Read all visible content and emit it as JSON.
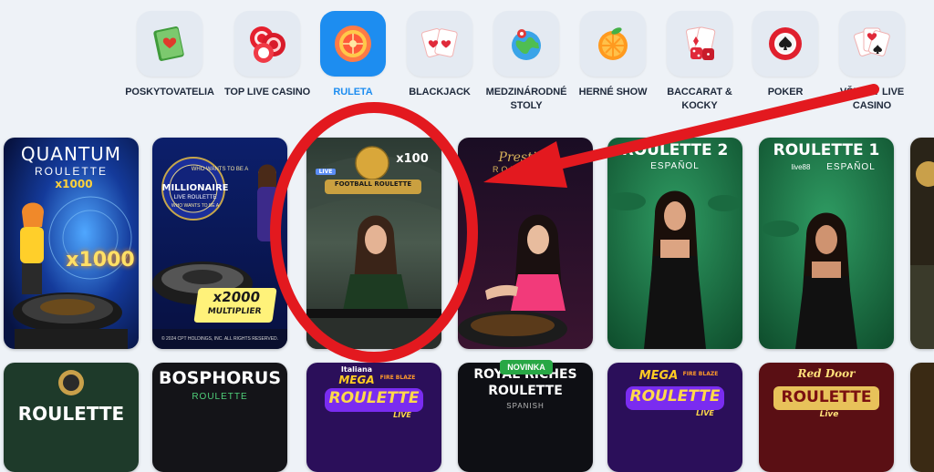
{
  "categories": [
    {
      "label": "POSKYTOVATELIA",
      "icon": "book-heart-icon"
    },
    {
      "label": "TOP LIVE CASINO",
      "icon": "casino-chips-icon"
    },
    {
      "label": "RULETA",
      "icon": "roulette-icon",
      "active": true
    },
    {
      "label": "BLACKJACK",
      "icon": "playing-cards-heart-icon"
    },
    {
      "label": "MEDZINÁRODNÉ STOLY",
      "icon": "globe-pin-icon"
    },
    {
      "label": "HERNÉ SHOW",
      "icon": "orange-slice-icon"
    },
    {
      "label": "BACCARAT & KOCKY",
      "icon": "cards-dice-icon"
    },
    {
      "label": "POKER",
      "icon": "poker-chip-icon"
    },
    {
      "label": "VŠETKY LIVE CASINO",
      "icon": "all-cards-icon"
    }
  ],
  "games_row1": [
    {
      "title": "QUANTUM",
      "subtitle": "ROULETTE",
      "badge": "x1000",
      "badge2": "x1000"
    },
    {
      "title": "MILLIONAIRE",
      "subtitle": "LIVE ROULETTE",
      "top_text": "WHO WANTS TO BE A",
      "bottom_text": "WHO WANTS TO BE A",
      "badge": "x2000",
      "badge2": "MULTIPLIER",
      "copyright": "© 2024 CPT HOLDINGS, INC. ALL RIGHTS RESERVED."
    },
    {
      "title": "FOOTBALL ROULETTE",
      "badge": "x100",
      "live": "LIVE"
    },
    {
      "title": "Prestige",
      "subtitle": "ROULETTE"
    },
    {
      "title": "ROULETTE 2",
      "subtitle": "ESPAÑOL"
    },
    {
      "title": "ROULETTE 1",
      "subtitle": "ESPAÑOL",
      "brand": "live88"
    }
  ],
  "games_row2": [
    {
      "title": "ROULETTE"
    },
    {
      "title": "BOSPHORUS",
      "subtitle": "ROULETTE"
    },
    {
      "title": "ROULETTE",
      "tag": "Italiana",
      "mega": "MEGA",
      "fire": "FIRE BLAZE",
      "live": "LIVE"
    },
    {
      "title": "ROYAL RICHES",
      "title2": "ROULETTE",
      "subtitle": "SPANISH",
      "badge": "NOVINKA"
    },
    {
      "title": "ROULETTE",
      "mega": "MEGA",
      "fire": "FIRE BLAZE",
      "live": "LIVE"
    },
    {
      "title": "ROULETTE",
      "tag": "Red Door",
      "live": "Live"
    }
  ],
  "colors": {
    "accent": "#1d8df0",
    "annotation": "#e3191f",
    "novinka": "#28a745"
  }
}
